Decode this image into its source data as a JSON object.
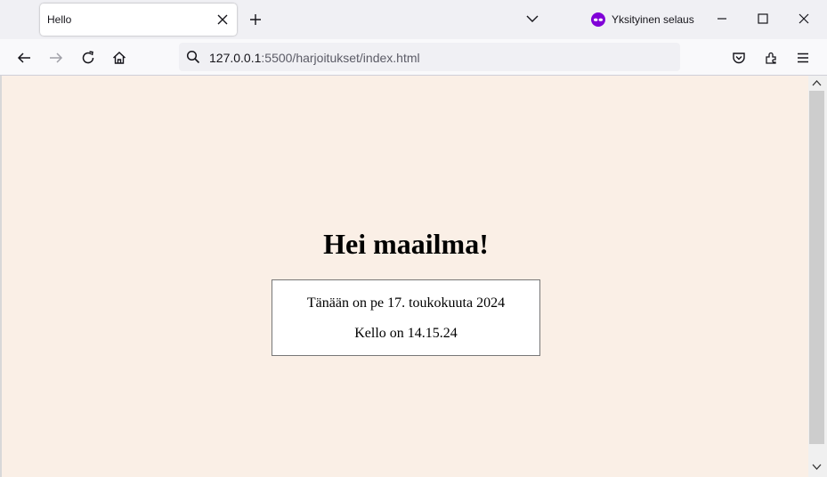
{
  "tab": {
    "title": "Hello"
  },
  "browser": {
    "private_label": "Yksityinen selaus"
  },
  "urlbar": {
    "host": "127.0.0.1",
    "path": ":5500/harjoitukset/index.html"
  },
  "page": {
    "heading": "Hei maailma!",
    "date_text": "Tänään on pe 17. toukokuuta 2024",
    "time_text": "Kello on 14.15.24"
  },
  "icons": {
    "tab_close": "close-icon",
    "new_tab": "plus-icon",
    "tab_list": "chevron-down-icon",
    "private": "private-mask-icon",
    "minimize": "minimize-icon",
    "maximize": "maximize-icon",
    "close": "close-icon",
    "back": "arrow-left-icon",
    "forward": "arrow-right-icon",
    "reload": "reload-icon",
    "home": "home-icon",
    "search": "search-icon",
    "pocket": "pocket-icon",
    "extensions": "extensions-icon",
    "menu": "hamburger-menu-icon"
  },
  "colors": {
    "page_background": "#faefe6",
    "private_accent": "#8000d7"
  }
}
